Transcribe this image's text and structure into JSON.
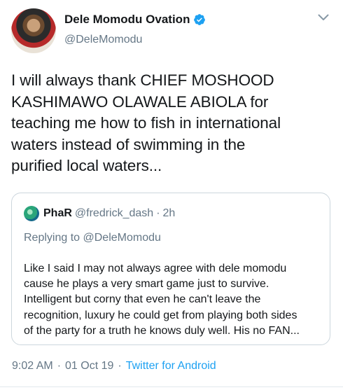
{
  "author": {
    "name": "Dele Momodu Ovation",
    "handle": "@DeleMomodu",
    "verified": true
  },
  "tweet": {
    "lines": [
      "I will always thank CHIEF MOSHOOD",
      "KASHIMAWO OLAWALE ABIOLA for",
      "teaching me how to fish in international",
      "waters instead of swimming in the",
      "purified local waters..."
    ]
  },
  "quote": {
    "name": "PhaR",
    "handle": "@fredrick_dash",
    "separator": "·",
    "time": "2h",
    "replying": "Replying to @DeleMomodu",
    "lines": [
      "Like I said I may not always agree with dele momodu",
      "cause he plays a very smart game just to survive.",
      "Intelligent but corny that even he can't leave the",
      "recognition, luxury he could get from playing both sides",
      "of the party for a truth he knows duly well. His no FAN..."
    ]
  },
  "meta": {
    "time": "9:02 AM",
    "separator": "·",
    "date": "01 Oct 19",
    "source": "Twitter for Android"
  },
  "colors": {
    "accent": "#1da1f2",
    "secondary_text": "#657786",
    "border": "#ccd6dd"
  },
  "icons": {
    "verified": "verified-badge-icon",
    "caret": "chevron-down-icon"
  }
}
